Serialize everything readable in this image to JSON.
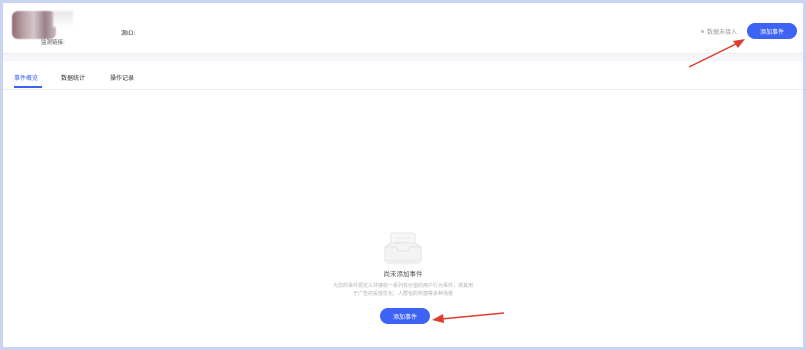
{
  "header": {
    "monitor_link_label": "监测链接:",
    "source_id_label": "源ID:",
    "status_text": "数据未接入",
    "add_event_button": "添加事件"
  },
  "tabs": [
    {
      "label": "事件概览",
      "active": true
    },
    {
      "label": "数据统计",
      "active": false
    },
    {
      "label": "操作记录",
      "active": false
    }
  ],
  "empty_state": {
    "title": "尚未添加事件",
    "description_line1": "为您的事件源定义并接收一系列有价值的用户行为事件，将其用",
    "description_line2": "于广告的投放优化、人群包的构建等多种场景",
    "add_event_button": "添加事件"
  },
  "colors": {
    "accent": "#3d63f5",
    "annotation_arrow": "#e23a2d",
    "page_border": "#c9d3f2"
  }
}
